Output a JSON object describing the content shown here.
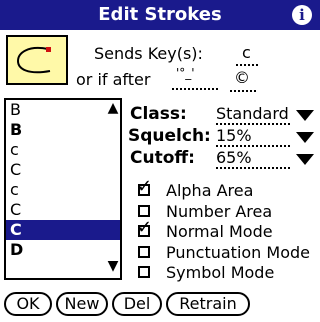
{
  "title": "Edit Strokes",
  "info_icon": "info-icon",
  "stroke_preview": {
    "description_icon": "stroke-c-icon"
  },
  "sends_key": {
    "label": "Sends Key(s):",
    "value": "c"
  },
  "or_if_after": {
    "label": "or if after",
    "glyph": "'°_'",
    "value": "©"
  },
  "strokes": [
    {
      "label": "B",
      "bold": false
    },
    {
      "label": "B",
      "bold": true
    },
    {
      "label": "c",
      "bold": false
    },
    {
      "label": "C",
      "bold": false
    },
    {
      "label": "c",
      "bold": false
    },
    {
      "label": "C",
      "bold": false
    },
    {
      "label": "C",
      "bold": true,
      "selected": true
    },
    {
      "label": "D",
      "bold": true
    }
  ],
  "class": {
    "label": "Class:",
    "value": "Standard"
  },
  "squelch": {
    "label": "Squelch:",
    "value": "15%"
  },
  "cutoff": {
    "label": "Cutoff:",
    "value": "65%"
  },
  "modes": [
    {
      "label": "Alpha Area",
      "checked": true
    },
    {
      "label": "Number Area",
      "checked": false
    },
    {
      "label": "Normal Mode",
      "checked": true
    },
    {
      "label": "Punctuation Mode",
      "checked": false
    },
    {
      "label": "Symbol Mode",
      "checked": false
    }
  ],
  "buttons": {
    "ok": "OK",
    "new": "New",
    "del": "Del",
    "retrain": "Retrain"
  }
}
